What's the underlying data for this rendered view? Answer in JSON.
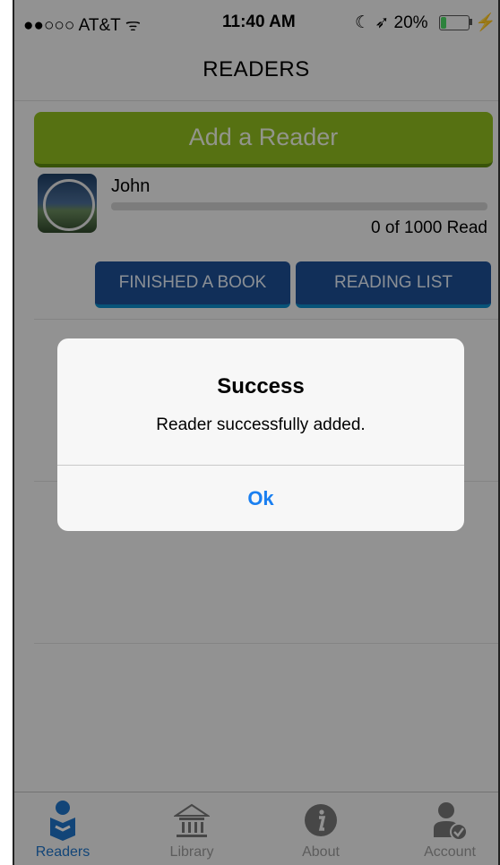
{
  "status_bar": {
    "carrier": "●●○○○ AT&T",
    "time": "11:40 AM",
    "battery": "20%",
    "battery_fraction": 0.2
  },
  "nav": {
    "title": "READERS"
  },
  "add_reader_label": "Add a Reader",
  "reader": {
    "name": "John",
    "read_count": "0 of 1000 Read",
    "progress_fraction": 0.0
  },
  "actions": {
    "finished_label": "FINISHED A BOOK",
    "reading_list_label": "READING LIST"
  },
  "alert": {
    "title": "Success",
    "message": "Reader successfully added.",
    "ok_label": "Ok"
  },
  "tabs": [
    {
      "label": "Readers",
      "icon": "reader-icon",
      "active": true
    },
    {
      "label": "Library",
      "icon": "library-icon",
      "active": false
    },
    {
      "label": "About",
      "icon": "info-icon",
      "active": false
    },
    {
      "label": "Account",
      "icon": "account-icon",
      "active": false
    }
  ],
  "colors": {
    "accent_green": "#8fbc1e",
    "button_blue": "#1d4f94",
    "link_blue": "#1a7ff0",
    "tab_active": "#1e73c8"
  }
}
